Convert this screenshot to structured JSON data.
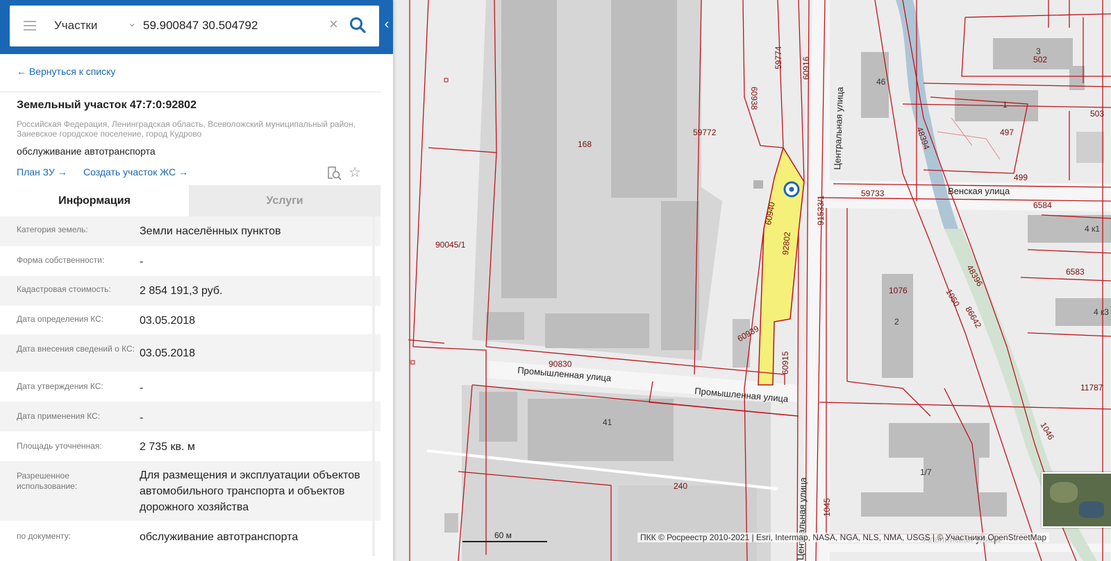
{
  "search": {
    "type_label": "Участки",
    "query": "59.900847 30.504792"
  },
  "panel": {
    "back_link": "← Вернуться к списку",
    "title": "Земельный участок 47:7:0:92802",
    "address": "Российская Федерация, Ленинградская область, Всеволожский муниципальный район, Заневское городское поселение, город Кудрово",
    "purpose": "обслуживание автотранспорта",
    "plan_link": "План ЗУ →",
    "create_link": "Создать участок ЖС →",
    "tabs": [
      {
        "label": "Информация",
        "active": true
      },
      {
        "label": "Услуги",
        "active": false
      }
    ],
    "info_rows": [
      {
        "key": "Категория земель:",
        "value": "Земли населённых пунктов"
      },
      {
        "key": "Форма собственности:",
        "value": "-"
      },
      {
        "key": "Кадастровая стоимость:",
        "value": "2 854 191,3 руб."
      },
      {
        "key": "Дата определения КС:",
        "value": "03.05.2018"
      },
      {
        "key": "Дата внесения сведений о КС:",
        "value": "03.05.2018"
      },
      {
        "key": "Дата утверждения КС:",
        "value": "-"
      },
      {
        "key": "Дата применения КС:",
        "value": "-"
      },
      {
        "key": "Площадь уточненная:",
        "value": "2 735 кв. м"
      },
      {
        "key": "Разрешенное использование:",
        "value": "Для размещения и эксплуатации объектов автомобильного транспорта и объектов дорожного хозяйства"
      },
      {
        "key": "по документу:",
        "value": "обслуживание автотранспорта"
      }
    ]
  },
  "map": {
    "parcel_labels": [
      "168",
      "90045/1",
      "59772",
      "59774",
      "60916",
      "60938",
      "60940",
      "92802",
      "91533/1",
      "59733",
      "60939",
      "60915",
      "90830",
      "240",
      "46",
      "502",
      "497",
      "499",
      "503",
      "6584",
      "6583",
      "1076",
      "48394",
      "48396",
      "1050",
      "86642",
      "1046",
      "1045",
      "11787"
    ],
    "building_labels": [
      "41",
      "3",
      "1",
      "2",
      "4 к1",
      "4 к3",
      "1/7"
    ],
    "streets": [
      "Промышленная улица",
      "Центральная улица",
      "Венская улица",
      "Альпийская улица"
    ],
    "selected_parcel": "92802",
    "scale_label": "60 м",
    "attribution": "ПКК © Росреестр 2010-2021 | Esri, Intermap, NASA, NGA, NLS, NMA, USGS | © Участники OpenStreetMap",
    "colors": {
      "parcel_border": "#c0141c",
      "selected_fill": "#f5f07a",
      "panel_header": "#1a68b5"
    }
  }
}
